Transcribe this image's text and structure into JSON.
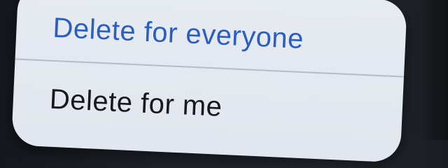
{
  "action_sheet": {
    "options": [
      {
        "label": "Delete for everyone",
        "accent": "#2a5ec2"
      },
      {
        "label": "Delete for me",
        "accent": "#17191d"
      }
    ]
  },
  "colors": {
    "sheet_background": "#e4e8ef",
    "page_background": "#1e2228",
    "divider": "#b6bcc6"
  }
}
